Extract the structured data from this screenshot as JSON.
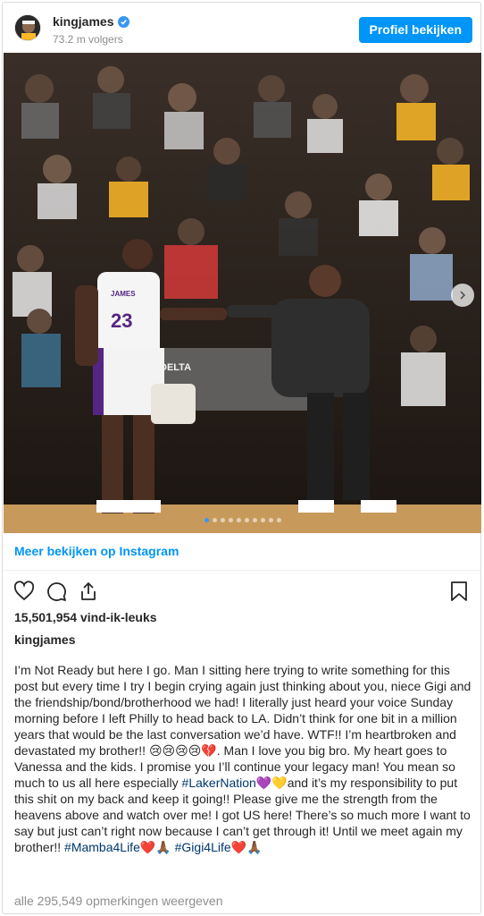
{
  "header": {
    "username": "kingjames",
    "followers": "73.2 m volgers",
    "profile_button": "Profiel bekijken",
    "verified_icon": "verified-badge-icon"
  },
  "photo": {
    "description_icon": "photo-lakers-courtside",
    "jersey_number": "23",
    "jersey_name": "JAMES",
    "sign_text": "DELTA",
    "carousel_total": 10,
    "carousel_active": 0,
    "next_icon": "chevron-right-icon"
  },
  "links": {
    "more": "Meer bekijken op Instagram"
  },
  "actions": {
    "icons": [
      "heart-icon",
      "comment-icon",
      "share-icon",
      "bookmark-icon"
    ]
  },
  "likes": "15,501,954 vind-ik-leuks",
  "caption": {
    "username": "kingjames",
    "part1": "I’m Not Ready but here I go. Man I sitting here trying to write something for this post but every time I try I begin crying again just thinking about you, niece Gigi and the friendship/bond/brotherhood we had! I literally just heard your voice Sunday morning before I left Philly to head back to LA. Didn’t think for one bit in a million years that would be the last conversation we’d have. WTF!! I’m heartbroken and devastated my brother!! 😢😢😢😢💔. Man I love you big bro. My heart goes to Vanessa and the kids. I promise you I’ll continue your legacy man! You mean so much to us all here especially ",
    "tag1": "#LakerNation",
    "part2": "💜💛and it’s my responsibility to put this shit on my back and keep it going!! Please give me the strength from the heavens above and watch over me! I got US here! There’s so much more I want to say but just can’t right now because I can’t get through it! Until we meet again my brother!! ",
    "tag2": "#Mamba4Life",
    "part3": "❤️🙏🏾 ",
    "tag3": "#Gigi4Life",
    "part4": "❤️🙏🏾"
  },
  "comments": "alle 295,549 opmerkingen weergeven",
  "colors": {
    "accent": "#0095f6",
    "hashtag": "#00376b",
    "muted": "#8e8e8e",
    "lakers_gold": "#fdb927",
    "lakers_purple": "#552583"
  }
}
